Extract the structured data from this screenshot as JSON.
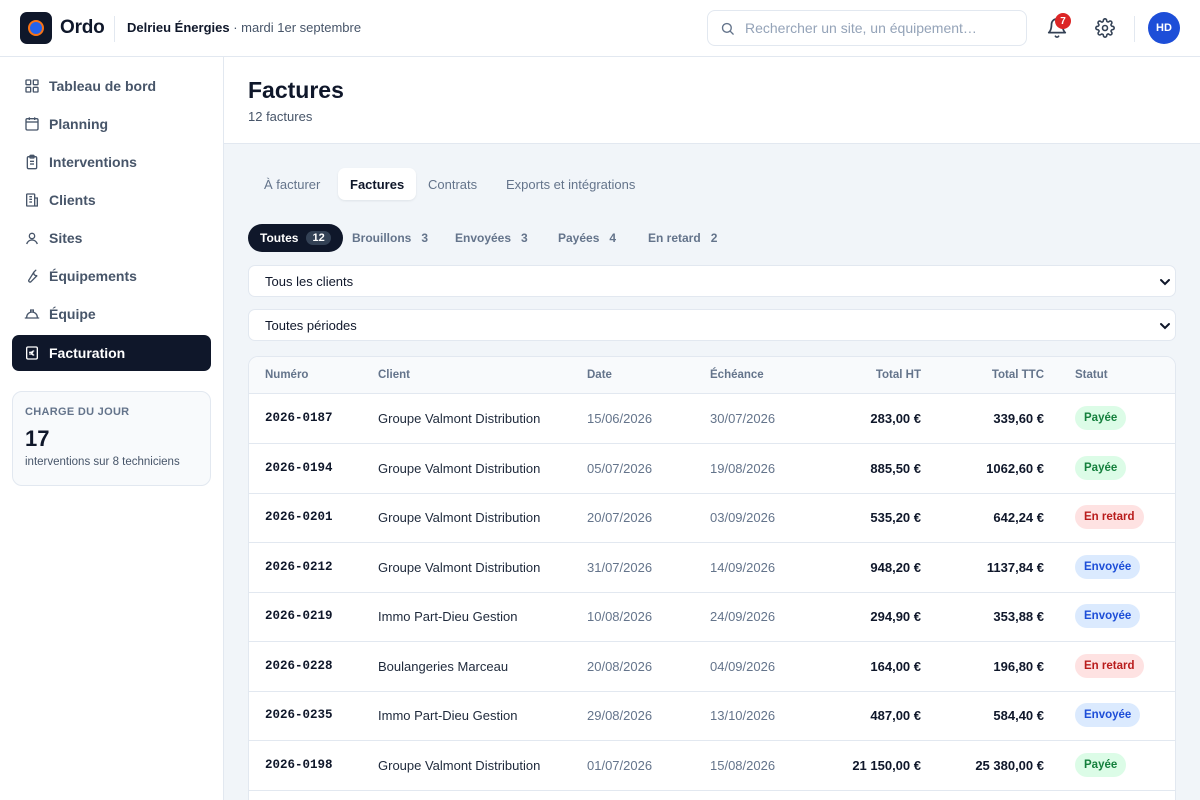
{
  "app": {
    "brand": "Ordo",
    "company": "Delrieu Énergies",
    "date": " · mardi 1er septembre",
    "notifications": "7",
    "avatar": "HD"
  },
  "search": {
    "placeholder": "Rechercher un site, un équipement…"
  },
  "sidebar": {
    "items": [
      {
        "label": "Tableau de bord",
        "icon": "dashboard-icon"
      },
      {
        "label": "Planning",
        "icon": "calendar-icon"
      },
      {
        "label": "Interventions",
        "icon": "clipboard-icon"
      },
      {
        "label": "Clients",
        "icon": "building-icon"
      },
      {
        "label": "Sites",
        "icon": "map-pin-icon"
      },
      {
        "label": "Équipements",
        "icon": "wrench-icon"
      },
      {
        "label": "Équipe",
        "icon": "hardhat-icon"
      },
      {
        "label": "Facturation",
        "icon": "euro-icon",
        "active": true
      }
    ],
    "load": {
      "label": "CHARGE DU JOUR",
      "value": "17",
      "caption": "interventions sur 8 techniciens"
    }
  },
  "page": {
    "title": "Factures",
    "subtitle": "12 factures"
  },
  "tabs": [
    {
      "label": "À facturer"
    },
    {
      "label": "Factures",
      "active": true
    },
    {
      "label": "Contrats"
    },
    {
      "label": "Exports et intégrations"
    }
  ],
  "chips": [
    {
      "label": "Toutes",
      "count": "12",
      "active": true
    },
    {
      "label": "Brouillons",
      "count": "3"
    },
    {
      "label": "Envoyées",
      "count": "3"
    },
    {
      "label": "Payées",
      "count": "4"
    },
    {
      "label": "En retard",
      "count": "2"
    }
  ],
  "filters": {
    "client": "Tous les clients",
    "period": "Toutes périodes"
  },
  "table": {
    "headers": [
      "Numéro",
      "Client",
      "Date",
      "Échéance",
      "Total HT",
      "Total TTC",
      "Statut"
    ],
    "rows": [
      {
        "numero": "2026-0187",
        "client": "Groupe Valmont Distribution",
        "date": "15/06/2026",
        "echeance": "30/07/2026",
        "ht": "283,00 €",
        "ttc": "339,60 €",
        "statut": "Payée",
        "kind": "payee"
      },
      {
        "numero": "2026-0194",
        "client": "Groupe Valmont Distribution",
        "date": "05/07/2026",
        "echeance": "19/08/2026",
        "ht": "885,50 €",
        "ttc": "1062,60 €",
        "statut": "Payée",
        "kind": "payee"
      },
      {
        "numero": "2026-0201",
        "client": "Groupe Valmont Distribution",
        "date": "20/07/2026",
        "echeance": "03/09/2026",
        "ht": "535,20 €",
        "ttc": "642,24 €",
        "statut": "En retard",
        "kind": "retard"
      },
      {
        "numero": "2026-0212",
        "client": "Groupe Valmont Distribution",
        "date": "31/07/2026",
        "echeance": "14/09/2026",
        "ht": "948,20 €",
        "ttc": "1137,84 €",
        "statut": "Envoyée",
        "kind": "envoyee"
      },
      {
        "numero": "2026-0219",
        "client": "Immo Part-Dieu Gestion",
        "date": "10/08/2026",
        "echeance": "24/09/2026",
        "ht": "294,90 €",
        "ttc": "353,88 €",
        "statut": "Envoyée",
        "kind": "envoyee"
      },
      {
        "numero": "2026-0228",
        "client": "Boulangeries Marceau",
        "date": "20/08/2026",
        "echeance": "04/09/2026",
        "ht": "164,00 €",
        "ttc": "196,80 €",
        "statut": "En retard",
        "kind": "retard"
      },
      {
        "numero": "2026-0235",
        "client": "Immo Part-Dieu Gestion",
        "date": "29/08/2026",
        "echeance": "13/10/2026",
        "ht": "487,00 €",
        "ttc": "584,40 €",
        "statut": "Envoyée",
        "kind": "envoyee"
      },
      {
        "numero": "2026-0198",
        "client": "Groupe Valmont Distribution",
        "date": "01/07/2026",
        "echeance": "15/08/2026",
        "ht": "21 150,00 €",
        "ttc": "25 380,00 €",
        "statut": "Payée",
        "kind": "payee"
      }
    ]
  }
}
